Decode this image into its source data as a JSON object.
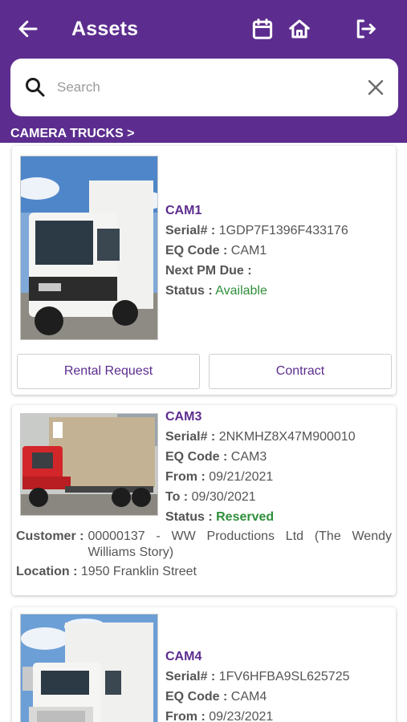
{
  "header": {
    "title": "Assets",
    "accent_color": "#5c2d8f",
    "icons": [
      "back-arrow-icon",
      "calendar-icon",
      "home-icon",
      "logout-icon"
    ]
  },
  "search": {
    "placeholder": "Search",
    "value": ""
  },
  "category": "CAMERA TRUCKS >",
  "labels": {
    "serial": "Serial# :",
    "eq_code": "EQ Code :",
    "next_pm": "Next PM Due :",
    "status": "Status :",
    "from": "From :",
    "to": "To :",
    "customer": "Customer :",
    "location": "Location :"
  },
  "assets": [
    {
      "name": "CAM1",
      "serial": "1GDP7F1396F433176",
      "eq_code": "CAM1",
      "next_pm_due": "",
      "status": "Available",
      "status_color": "#2f8f3a",
      "buttons": [
        "Rental Request",
        "Contract"
      ]
    },
    {
      "name": "CAM3",
      "serial": "2NKMHZ8X47M900010",
      "eq_code": "CAM3",
      "from": "09/21/2021",
      "to": "09/30/2021",
      "status": "Reserved",
      "status_color": "#2f8f3a",
      "customer": "00000137 - WW Productions Ltd (The Wendy Williams Story)",
      "location": "1950 Franklin Street"
    },
    {
      "name": "CAM4",
      "serial": "1FV6HFBA9SL625725",
      "eq_code": "CAM4",
      "from": "09/23/2021"
    }
  ]
}
